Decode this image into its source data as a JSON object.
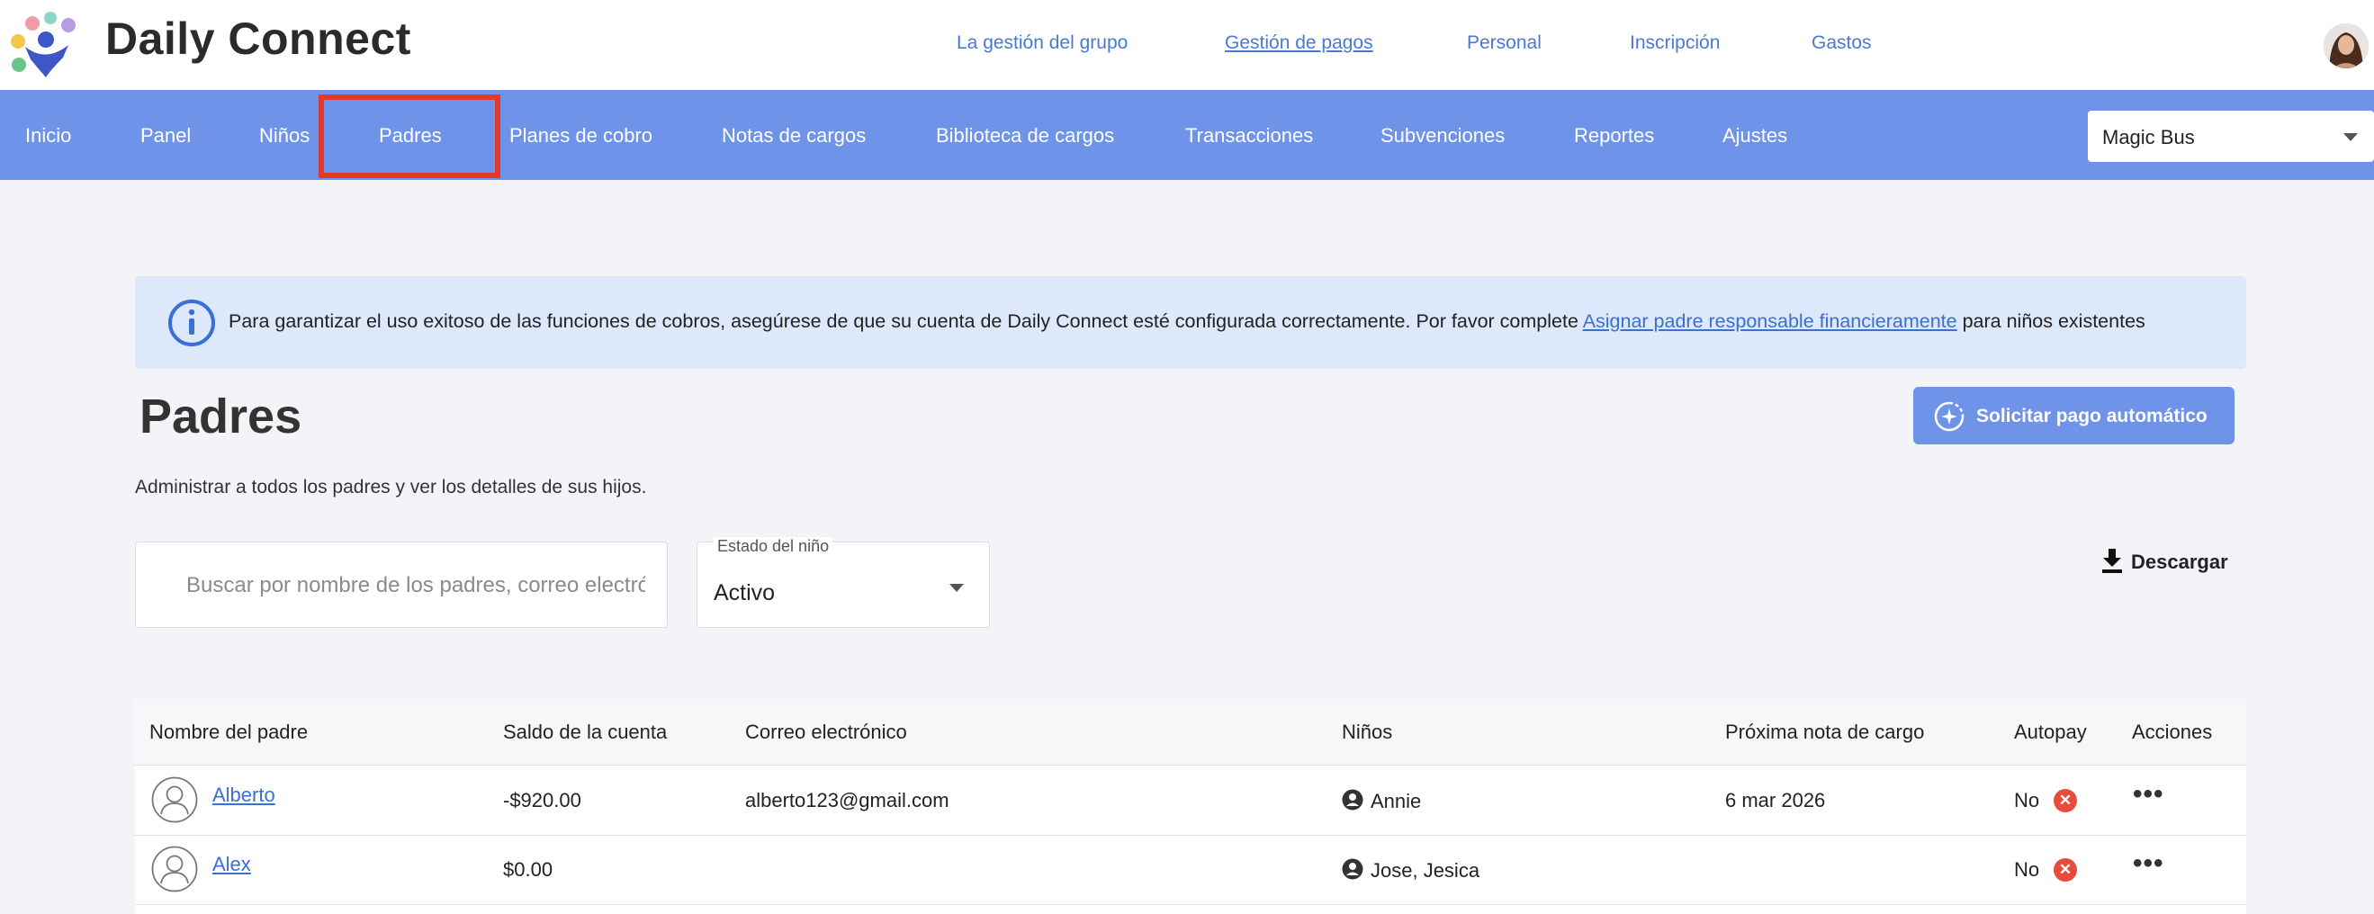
{
  "brand": {
    "name": "Daily Connect"
  },
  "top_nav": [
    {
      "label": "La gestión del grupo"
    },
    {
      "label": "Gestión de pagos"
    },
    {
      "label": "Personal"
    },
    {
      "label": "Inscripción"
    },
    {
      "label": "Gastos"
    }
  ],
  "nav": [
    {
      "label": "Inicio"
    },
    {
      "label": "Panel"
    },
    {
      "label": "Niños"
    },
    {
      "label": "Padres"
    },
    {
      "label": "Planes de cobro"
    },
    {
      "label": "Notas de cargos"
    },
    {
      "label": "Biblioteca de cargos"
    },
    {
      "label": "Transacciones"
    },
    {
      "label": "Subvenciones"
    },
    {
      "label": "Reportes"
    },
    {
      "label": "Ajustes"
    }
  ],
  "center_select": {
    "value": "Magic Bus"
  },
  "banner": {
    "text_before": "Para garantizar el uso exitoso de las funciones de cobros, asegúrese de que su cuenta de Daily Connect esté configurada correctamente. Por favor complete ",
    "link": "Asignar padre responsable financieramente",
    "text_after": " para niños existentes"
  },
  "page": {
    "title": "Padres",
    "subtitle": "Administrar a todos los padres y ver los detalles de sus hijos.",
    "auto_pay_button": "Solicitar pago automático"
  },
  "filters": {
    "search_placeholder": "Buscar por nombre de los padres, correo electrónico",
    "status_label": "Estado del niño",
    "status_value": "Activo",
    "download_label": "Descargar"
  },
  "table": {
    "columns": [
      "Nombre del padre",
      "Saldo de la cuenta",
      "Correo electrónico",
      "Niños",
      "Próxima nota de cargo",
      "Autopay",
      "Acciones"
    ],
    "rows": [
      {
        "name": "Alberto",
        "balance": "-$920.00",
        "email": "alberto123@gmail.com",
        "children": "Annie",
        "next_charge": "6 mar 2026",
        "autopay": "No"
      },
      {
        "name": "Alex",
        "balance": "$0.00",
        "email": "",
        "children": "Jose, Jesica",
        "next_charge": "",
        "autopay": "No"
      }
    ]
  },
  "colors": {
    "nav_bg": "#6f93e8",
    "link": "#3a6fd8",
    "banner_bg": "#dde8fb",
    "highlight": "#e23a2a",
    "danger": "#e84b3c"
  }
}
